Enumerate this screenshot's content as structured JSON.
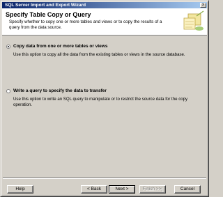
{
  "window": {
    "title": "SQL Server Import and Export Wizard",
    "close_glyph": "x"
  },
  "header": {
    "title": "Specify Table Copy or Query",
    "description": "Specify whether to copy one or more tables and views or to copy the results of a query from the data source.",
    "icon": "wizard-icon"
  },
  "options": [
    {
      "label": "Copy data from one or more tables or views",
      "description": "Use this option to copy all the data from the existing tables or views in the source database.",
      "selected": true
    },
    {
      "label": "Write a query to specify the data to transfer",
      "description": "Use this option to write an SQL query to manipulate or to restrict the source data for the copy operation.",
      "selected": false
    }
  ],
  "buttons": {
    "help": "Help",
    "back": "< Back",
    "next": "Next >",
    "finish": "Finish >>|",
    "cancel": "Cancel"
  }
}
